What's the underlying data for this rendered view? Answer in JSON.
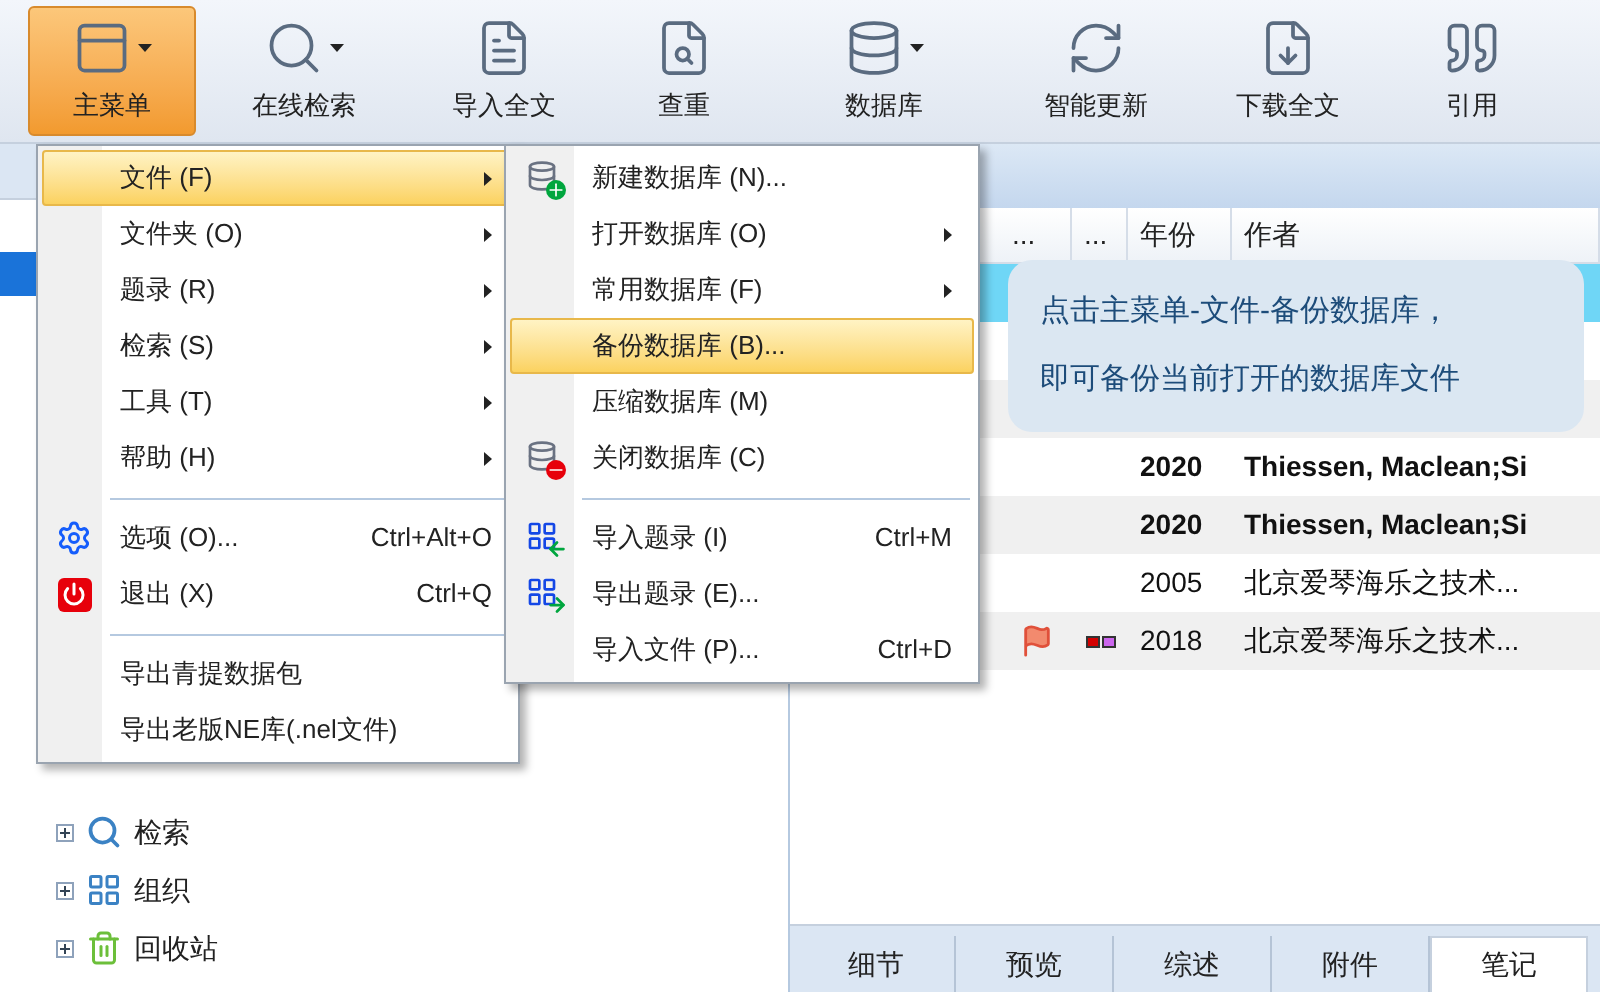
{
  "toolbar": [
    {
      "label": "主菜单",
      "selected": true,
      "dropdown": true
    },
    {
      "label": "在线检索",
      "selected": false,
      "dropdown": true
    },
    {
      "label": "导入全文",
      "selected": false,
      "dropdown": false
    },
    {
      "label": "查重",
      "selected": false,
      "dropdown": false
    },
    {
      "label": "数据库",
      "selected": false,
      "dropdown": true
    },
    {
      "label": "智能更新",
      "selected": false,
      "dropdown": false
    },
    {
      "label": "下载全文",
      "selected": false,
      "dropdown": false
    },
    {
      "label": "引用",
      "selected": false,
      "dropdown": false
    }
  ],
  "main_menu": {
    "items": [
      {
        "kind": "item",
        "label": "文件 (F)",
        "submenu": true,
        "selected": true,
        "expanded": true,
        "children": [
          {
            "kind": "item",
            "label": "新建数据库 (N)...",
            "submenu": false,
            "selected": false
          },
          {
            "kind": "item",
            "label": "打开数据库 (O)",
            "submenu": true,
            "selected": false
          },
          {
            "kind": "item",
            "label": "常用数据库 (F)",
            "submenu": true,
            "selected": false
          },
          {
            "kind": "item",
            "label": "备份数据库 (B)...",
            "submenu": false,
            "selected": true
          },
          {
            "kind": "item",
            "label": "压缩数据库 (M)",
            "submenu": false,
            "selected": false
          },
          {
            "kind": "item",
            "label": "关闭数据库 (C)",
            "submenu": false,
            "selected": false
          },
          {
            "kind": "separator"
          },
          {
            "kind": "item",
            "label": "导入题录 (I)",
            "shortcut": "Ctrl+M",
            "submenu": false,
            "selected": false
          },
          {
            "kind": "item",
            "label": "导出题录 (E)...",
            "submenu": false,
            "selected": false
          },
          {
            "kind": "item",
            "label": "导入文件 (P)...",
            "shortcut": "Ctrl+D",
            "submenu": false,
            "selected": false
          }
        ]
      },
      {
        "kind": "item",
        "label": "文件夹 (O)",
        "submenu": true,
        "selected": false
      },
      {
        "kind": "item",
        "label": "题录 (R)",
        "submenu": true,
        "selected": false
      },
      {
        "kind": "item",
        "label": "检索 (S)",
        "submenu": true,
        "selected": false
      },
      {
        "kind": "item",
        "label": "工具 (T)",
        "submenu": true,
        "selected": false
      },
      {
        "kind": "item",
        "label": "帮助 (H)",
        "submenu": true,
        "selected": false
      },
      {
        "kind": "separator"
      },
      {
        "kind": "item",
        "label": "选项 (O)...",
        "shortcut": "Ctrl+Alt+O",
        "submenu": false,
        "selected": false
      },
      {
        "kind": "item",
        "label": "退出 (X)",
        "shortcut": "Ctrl+Q",
        "submenu": false,
        "selected": false
      },
      {
        "kind": "separator"
      },
      {
        "kind": "item",
        "label": "导出青提数据包",
        "submenu": false,
        "selected": false
      },
      {
        "kind": "item",
        "label": "导出老版NE库(.nel文件)",
        "submenu": false,
        "selected": false
      }
    ]
  },
  "tree": {
    "items": [
      {
        "label": "检索",
        "expanded": false
      },
      {
        "label": "组织",
        "expanded": false
      },
      {
        "label": "回收站",
        "expanded": false
      }
    ]
  },
  "table": {
    "columns": [
      "...",
      "...",
      "年份",
      "作者"
    ],
    "rows": [
      {
        "selected": true
      },
      {
        "selected": false
      },
      {
        "selected": false,
        "year": "2020",
        "author": "Thiessen, Maclean;Si",
        "unread": true,
        "flagged": false
      },
      {
        "selected": false,
        "year": "2020",
        "author": "Thiessen, Maclean;Si",
        "unread": true,
        "flagged": false
      },
      {
        "selected": false,
        "year": "2005",
        "author": "北京爱琴海乐之技术...",
        "unread": false,
        "flagged": false
      },
      {
        "selected": false,
        "year": "2018",
        "author": "北京爱琴海乐之技术...",
        "unread": false,
        "flagged": true,
        "tags": [
          {
            "color": "#d40000"
          },
          {
            "color": "#cc66ee"
          }
        ]
      }
    ]
  },
  "tooltip": {
    "lines": [
      "点击主菜单-文件-备份数据库，",
      "即可备份当前打开的数据库文件"
    ]
  },
  "bottom_tabs": [
    {
      "label": "细节",
      "selected": false
    },
    {
      "label": "预览",
      "selected": false
    },
    {
      "label": "综述",
      "selected": false
    },
    {
      "label": "附件",
      "selected": false
    },
    {
      "label": "笔记",
      "selected": true
    }
  ]
}
